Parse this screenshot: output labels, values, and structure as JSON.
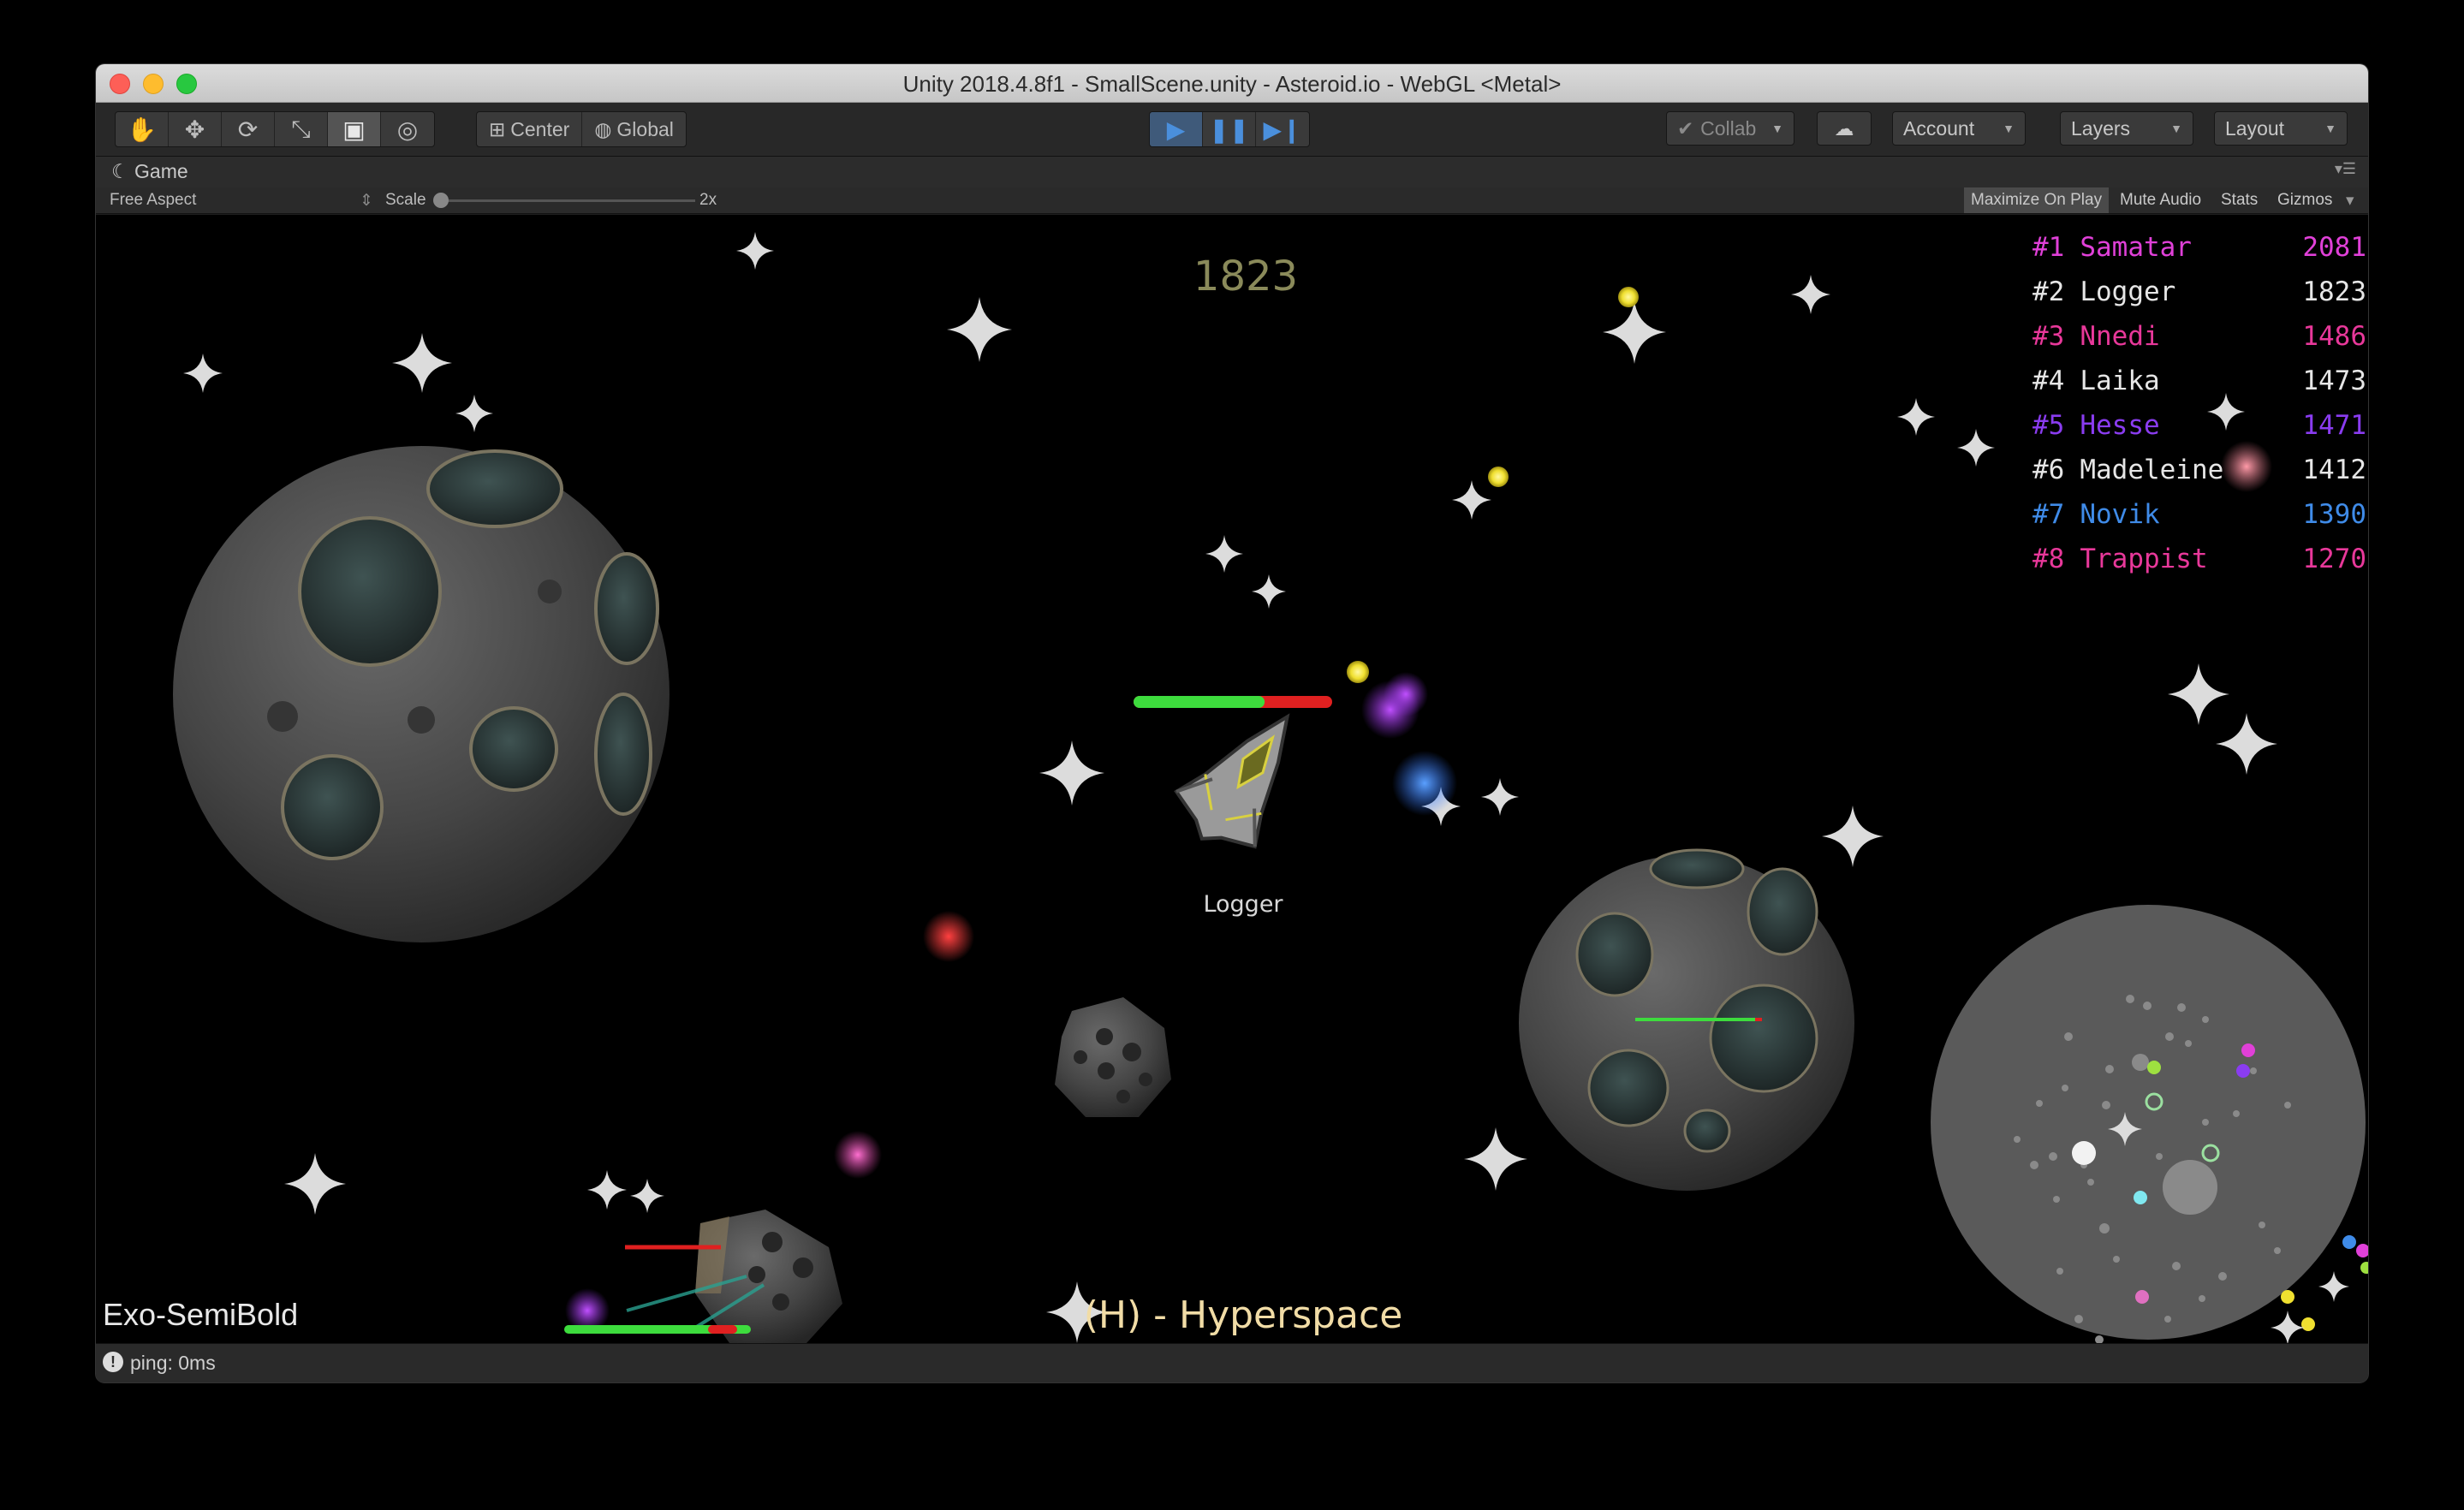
{
  "window": {
    "title": "Unity 2018.4.8f1 - SmallScene.unity - Asteroid.io - WebGL <Metal>"
  },
  "toolbar": {
    "tools": [
      {
        "name": "hand-tool",
        "glyph": "✋"
      },
      {
        "name": "move-tool",
        "glyph": "✥"
      },
      {
        "name": "rotate-tool",
        "glyph": "⟳"
      },
      {
        "name": "scale-tool",
        "glyph": "⤡"
      },
      {
        "name": "rect-tool",
        "glyph": "▣"
      },
      {
        "name": "transform-tool",
        "glyph": "◎"
      }
    ],
    "center_label": "Center",
    "global_label": "Global",
    "collab_label": "Collab",
    "account_label": "Account",
    "layers_label": "Layers",
    "layout_label": "Layout"
  },
  "game_tab": {
    "title": "Game",
    "aspect": "Free Aspect",
    "scale_label": "Scale",
    "scale_value": "2x",
    "maximize_on_play": "Maximize On Play",
    "mute_audio": "Mute Audio",
    "stats": "Stats",
    "gizmos": "Gizmos"
  },
  "hud": {
    "score": "1823",
    "player_name": "Logger",
    "hint": "(H) - Hyperspace",
    "font_label": "Exo-SemiBold",
    "player_health": 0.66,
    "leaderboard": [
      {
        "rank": "#1",
        "name": "Samatar",
        "score": "2081",
        "color": "#e040d8"
      },
      {
        "rank": "#2",
        "name": "Logger",
        "score": "1823",
        "color": "#e6e6e6"
      },
      {
        "rank": "#3",
        "name": "Nnedi",
        "score": "1486",
        "color": "#e8389a"
      },
      {
        "rank": "#4",
        "name": "Laika",
        "score": "1473",
        "color": "#e6e6e6"
      },
      {
        "rank": "#5",
        "name": "Hesse",
        "score": "1471",
        "color": "#8a3cf0"
      },
      {
        "rank": "#6",
        "name": "Madeleine",
        "score": "1412",
        "color": "#e6e6e6"
      },
      {
        "rank": "#7",
        "name": "Novik",
        "score": "1390",
        "color": "#3f8be8"
      },
      {
        "rank": "#8",
        "name": "Trappist",
        "score": "1270",
        "color": "#e8389a"
      }
    ]
  },
  "status": {
    "ping": "ping: 0ms"
  },
  "colors": {
    "health_green": "#3ddc3d",
    "health_red": "#e02020",
    "pellet_yellow": "#f0e030"
  }
}
